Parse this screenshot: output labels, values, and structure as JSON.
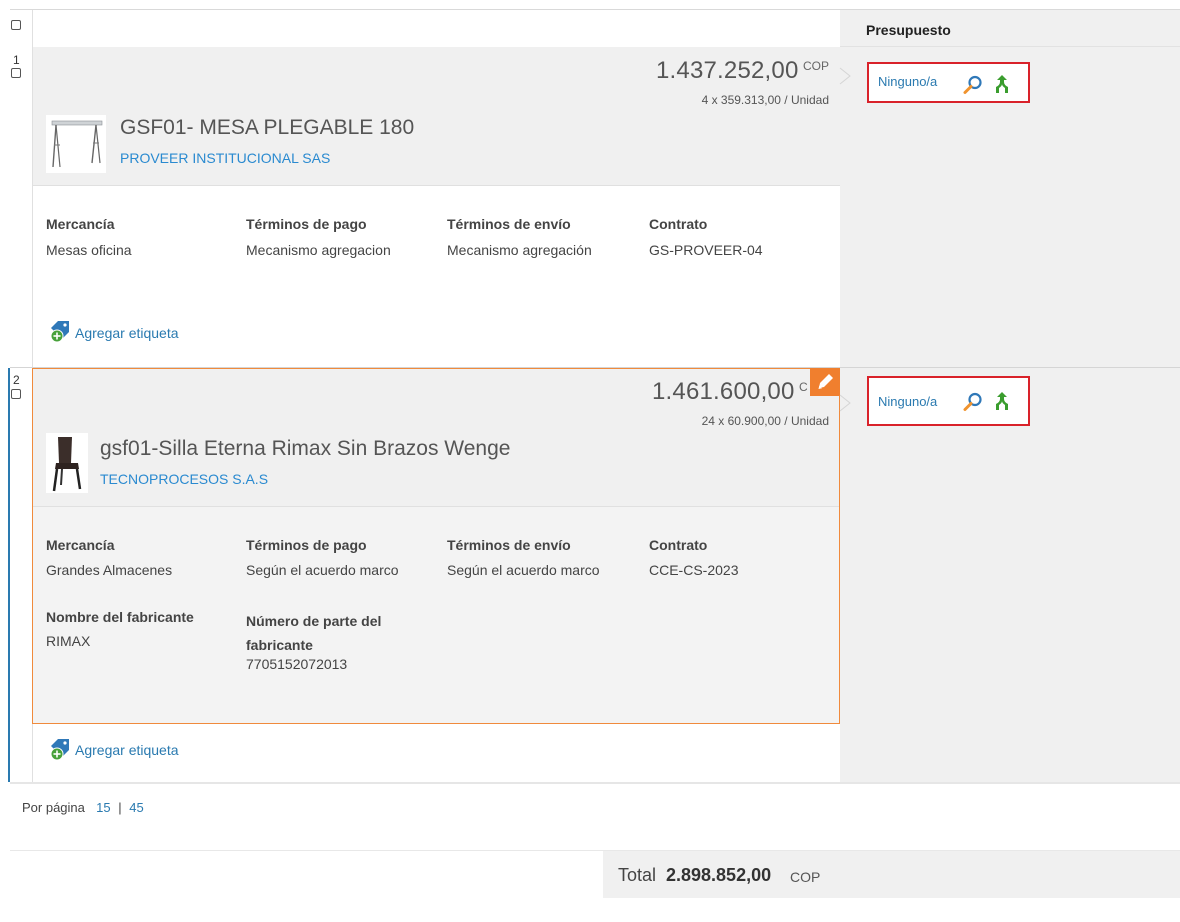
{
  "header": {
    "budget_col": "Presupuesto"
  },
  "items": [
    {
      "index": "1",
      "price": "1.437.252,00",
      "currency": "COP",
      "unit_line": "4 x 359.313,00 / Unidad",
      "title": "GSF01- MESA PLEGABLE 180",
      "supplier": "PROVEER INSTITUCIONAL SAS",
      "fields": [
        {
          "label": "Mercancía",
          "value": "Mesas oficina"
        },
        {
          "label": "Términos de pago",
          "value": "Mecanismo agregacion"
        },
        {
          "label": "Términos de envío",
          "value": "Mecanismo agregación"
        },
        {
          "label": "Contrato",
          "value": "GS-PROVEER-04"
        }
      ],
      "tag_label": "Agregar etiqueta",
      "budget": "Ninguno/a"
    },
    {
      "index": "2",
      "price": "1.461.600,00",
      "currency": "C",
      "unit_line": "24 x 60.900,00 / Unidad",
      "title": "gsf01-Silla Eterna Rimax Sin Brazos Wenge",
      "supplier": "TECNOPROCESOS S.A.S",
      "fields": [
        {
          "label": "Mercancía",
          "value": "Grandes Almacenes"
        },
        {
          "label": "Términos de pago",
          "value": "Según el acuerdo marco"
        },
        {
          "label": "Términos de envío",
          "value": "Según el acuerdo marco"
        },
        {
          "label": "Contrato",
          "value": "CCE-CS-2023"
        }
      ],
      "extra_fields": [
        {
          "label": "Nombre del fabricante",
          "value": "RIMAX"
        },
        {
          "label": "Número de parte del fabricante",
          "value": "7705152072013"
        }
      ],
      "tag_label": "Agregar etiqueta",
      "budget": "Ninguno/a"
    }
  ],
  "pagination": {
    "label": "Por página",
    "opt1": "15",
    "sep": "|",
    "opt2": "45"
  },
  "total": {
    "label": "Total",
    "amount": "2.898.852,00",
    "currency": "COP"
  },
  "colors": {
    "link": "#2a7ab0",
    "accent": "#f07f2e",
    "budget_border": "#d9222a",
    "split_icon": "#3a9d2e"
  }
}
